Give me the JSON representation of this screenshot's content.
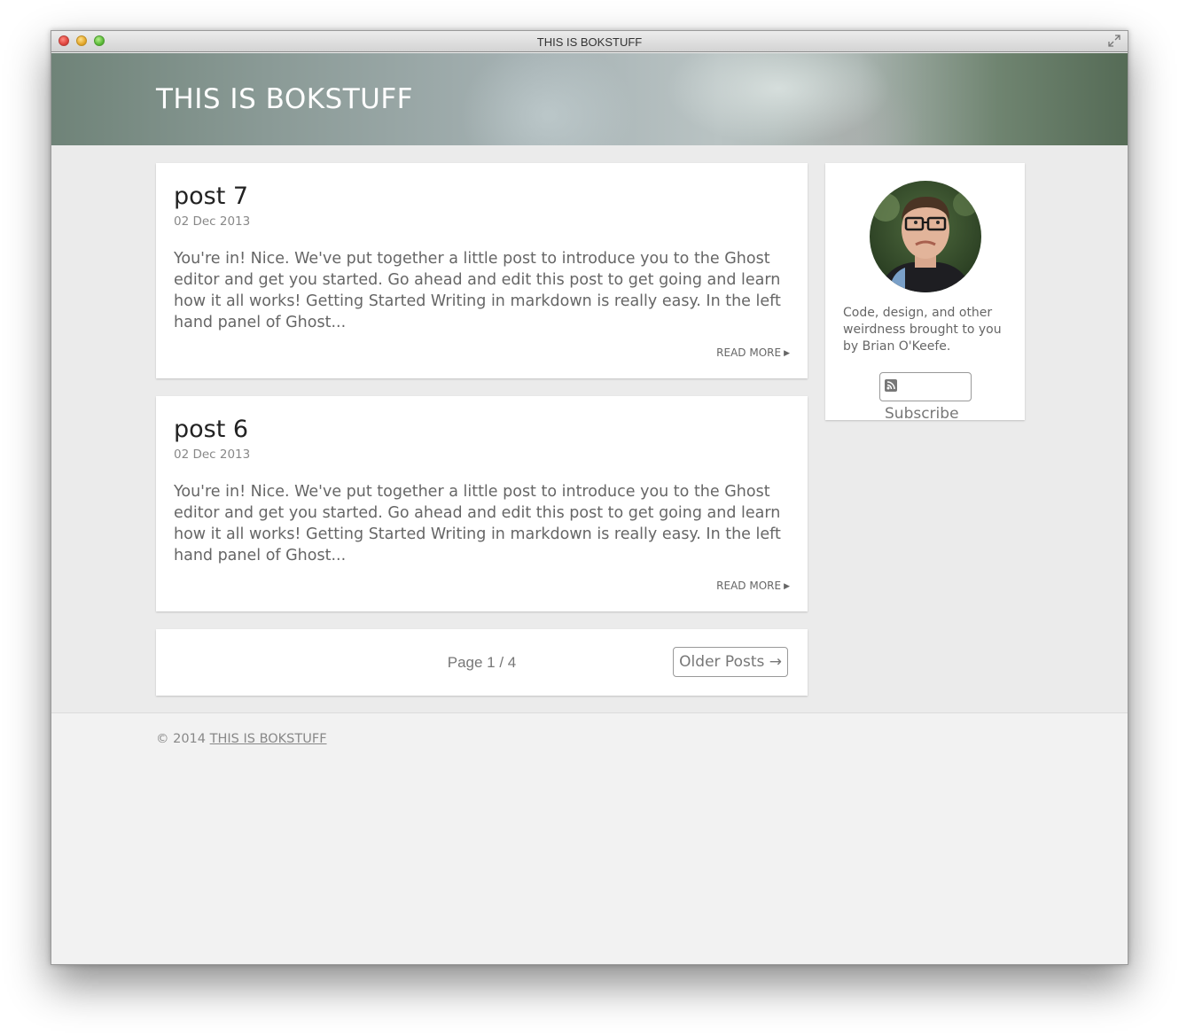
{
  "window": {
    "title": "THIS IS BOKSTUFF"
  },
  "header": {
    "site_title": "THIS IS BOKSTUFF"
  },
  "posts": [
    {
      "title": "post 7",
      "date": "02 Dec 2013",
      "excerpt": "You're in! Nice. We've put together a little post to introduce you to the Ghost editor and get you started. Go ahead and edit this post to get going and learn how it all works! Getting Started Writing in markdown is really easy. In the left hand panel of Ghost...",
      "read_more": "READ MORE"
    },
    {
      "title": "post 6",
      "date": "02 Dec 2013",
      "excerpt": "You're in! Nice. We've put together a little post to introduce you to the Ghost editor and get you started. Go ahead and edit this post to get going and learn how it all works! Getting Started Writing in markdown is really easy. In the left hand panel of Ghost...",
      "read_more": "READ MORE"
    }
  ],
  "pagination": {
    "page_label": "Page 1 / 4",
    "older_label": "Older Posts →"
  },
  "sidebar": {
    "bio": "Code, design, and other weirdness brought to you by Brian O'Keefe.",
    "subscribe_label": "Subscribe"
  },
  "footer": {
    "copyright": "© 2014",
    "link_label": "THIS IS BOKSTUFF"
  }
}
